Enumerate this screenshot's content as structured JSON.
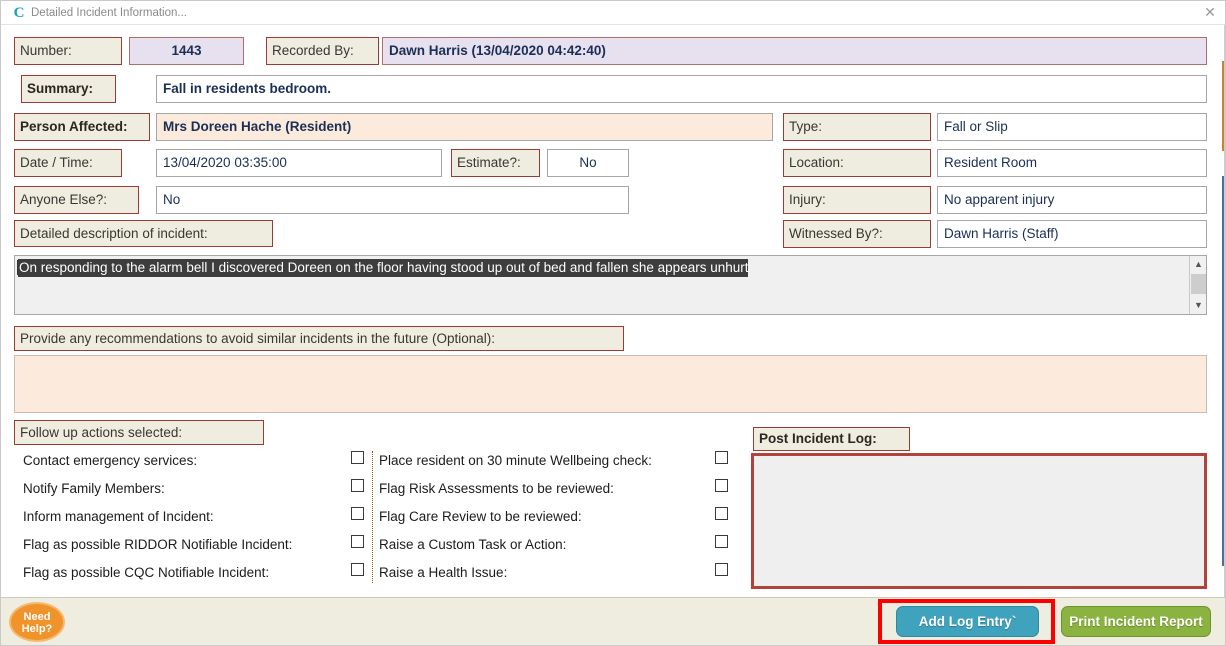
{
  "window": {
    "title": "Detailed Incident Information...",
    "logo_glyph": "C",
    "close_glyph": "✕"
  },
  "header": {
    "number_label": "Number:",
    "number_value": "1443",
    "recorded_by_label": "Recorded By:",
    "recorded_by_value": "Dawn Harris (13/04/2020 04:42:40)",
    "summary_label": "Summary:",
    "summary_value": "Fall in residents bedroom."
  },
  "left_fields": {
    "person_affected_label": "Person Affected:",
    "person_affected_value": "Mrs Doreen Hache (Resident)",
    "date_time_label": "Date / Time:",
    "date_time_value": "13/04/2020 03:35:00",
    "estimate_label": "Estimate?:",
    "estimate_value": "No",
    "anyone_else_label": "Anyone Else?:",
    "anyone_else_value": "No"
  },
  "right_fields": {
    "type_label": "Type:",
    "type_value": "Fall or Slip",
    "location_label": "Location:",
    "location_value": "Resident Room",
    "injury_label": "Injury:",
    "injury_value": "No apparent injury",
    "witnessed_by_label": "Witnessed By?:",
    "witnessed_by_value": "Dawn Harris (Staff)"
  },
  "description": {
    "label": "Detailed description of incident:",
    "value": "On responding to the alarm bell I discovered Doreen on the floor having stood up out of bed and fallen she appears unhurt",
    "scroll_up_glyph": "▲",
    "scroll_down_glyph": "▼"
  },
  "recommendations": {
    "label": "Provide any recommendations to avoid similar incidents in the future (Optional):",
    "value": ""
  },
  "follow_up": {
    "header_label": "Follow up actions selected:",
    "column_left": [
      {
        "label": "Contact emergency services:",
        "checked": false
      },
      {
        "label": "Notify Family Members:",
        "checked": false
      },
      {
        "label": "Inform management of Incident:",
        "checked": false
      },
      {
        "label": "Flag as possible RIDDOR Notifiable Incident:",
        "checked": false
      },
      {
        "label": "Flag as possible CQC Notifiable Incident:",
        "checked": false
      }
    ],
    "column_right": [
      {
        "label": "Place resident on 30 minute Wellbeing check:",
        "checked": false
      },
      {
        "label": "Flag Risk Assessments to be reviewed:",
        "checked": false
      },
      {
        "label": "Flag Care Review to be reviewed:",
        "checked": false
      },
      {
        "label": "Raise a Custom Task or Action:",
        "checked": false
      },
      {
        "label": "Raise a Health Issue:",
        "checked": false
      }
    ]
  },
  "post_incident_log": {
    "label": "Post Incident Log:",
    "value": ""
  },
  "footer": {
    "need_help_line1": "Need",
    "need_help_line2": "Help?",
    "add_log_entry_label": "Add Log Entry`",
    "print_incident_report_label": "Print Incident Report"
  },
  "colors": {
    "label_bg": "#efeddf",
    "label_border": "#9c3a34",
    "value_text": "#1b2f56",
    "lilac_bg": "#e6e0ef",
    "peach_bg": "#fceadc",
    "highlight_red": "#ff0000",
    "log_border": "#b0443c",
    "teal_button": "#3fa3bd",
    "green_button": "#8bb33f",
    "help_orange": "#f0932b"
  }
}
